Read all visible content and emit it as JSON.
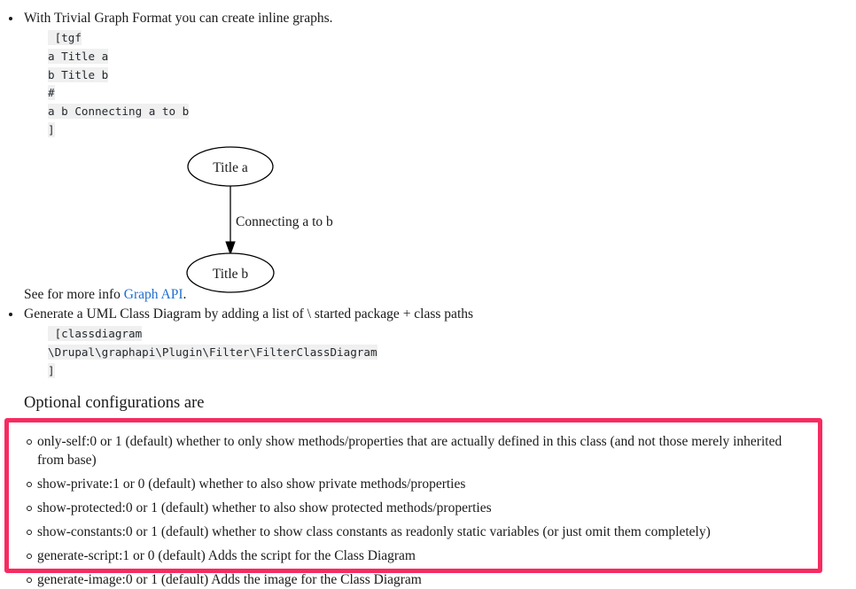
{
  "doc": {
    "bullet_1": {
      "text": "With Trivial Graph Format you can create inline graphs.",
      "code_lines": [
        " [tgf",
        "a Title a",
        "b Title b",
        "#",
        "a b Connecting a to b",
        "]"
      ]
    },
    "graph": {
      "node_a_label": "Title a",
      "node_b_label": "Title b",
      "edge_label": "Connecting a to b"
    },
    "see_more": {
      "prefix": "See for more info ",
      "link_text": "Graph API",
      "suffix": "."
    },
    "bullet_2": {
      "text": "Generate a UML Class Diagram by adding a list of \\ started package + class paths",
      "code_lines": [
        " [classdiagram",
        "\\Drupal\\graphapi\\Plugin\\Filter\\FilterClassDiagram",
        "]"
      ]
    },
    "options_heading": "Optional configurations are",
    "options": [
      "only-self:0 or 1 (default) whether to only show methods/properties that are actually defined in this class (and not those merely inherited from base)",
      "show-private:1 or 0 (default) whether to also show private methods/properties",
      "show-protected:0 or 1 (default) whether to also show protected methods/properties",
      "show-constants:0 or 1 (default) whether to show class constants as readonly static variables (or just omit them completely)",
      "generate-script:1 or 0 (default) Adds the script for the Class Diagram",
      "generate-image:0 or 1 (default) Adds the image for the Class Diagram"
    ],
    "colors": {
      "highlight_border": "#f72b60",
      "link": "#1f6fd0",
      "code_background": "#f0f0f0"
    }
  }
}
